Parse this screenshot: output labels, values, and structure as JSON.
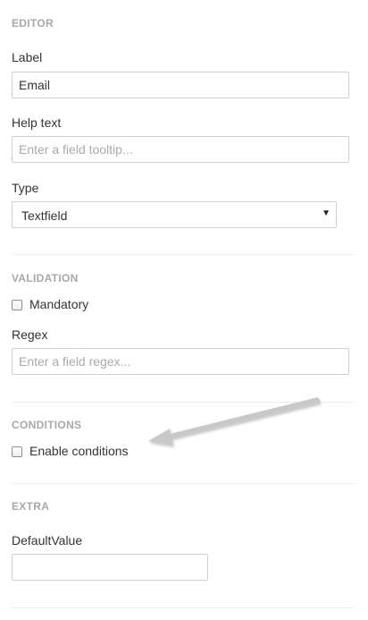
{
  "editor": {
    "title": "EDITOR",
    "label_field": {
      "label": "Label",
      "value": "Email"
    },
    "help_field": {
      "label": "Help text",
      "placeholder": "Enter a field tooltip..."
    },
    "type_field": {
      "label": "Type",
      "selected": "Textfield",
      "caret": "▼"
    }
  },
  "validation": {
    "title": "VALIDATION",
    "mandatory_label": "Mandatory",
    "regex_field": {
      "label": "Regex",
      "placeholder": "Enter a field regex..."
    }
  },
  "conditions": {
    "title": "CONDITIONS",
    "enable_label": "Enable conditions"
  },
  "extra": {
    "title": "EXTRA",
    "default_field": {
      "label": "DefaultValue",
      "value": ""
    }
  },
  "colors": {
    "section_title": "#a8a8a8",
    "border": "#cfcfcf",
    "annotation_arrow": "#c8c8c8"
  }
}
